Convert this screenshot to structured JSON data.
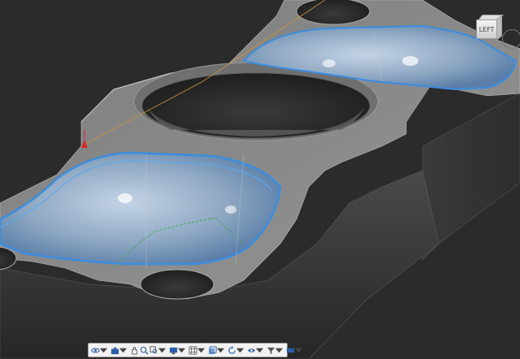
{
  "viewcube": {
    "face_label": "LEFT"
  },
  "toolbar": {
    "tools": [
      {
        "name": "orbit",
        "icon": "orbit-icon"
      },
      {
        "name": "orbit-dropdown",
        "icon": "chevron-down-icon"
      },
      {
        "name": "capture",
        "icon": "camera-icon"
      },
      {
        "name": "capture-dropdown",
        "icon": "chevron-down-icon"
      },
      {
        "name": "pan",
        "icon": "pan-icon"
      },
      {
        "name": "zoom",
        "icon": "zoom-icon"
      },
      {
        "name": "zoom-window",
        "icon": "zoom-window-icon"
      },
      {
        "name": "zoom-dropdown",
        "icon": "chevron-down-icon"
      },
      {
        "name": "display-mode",
        "icon": "display-icon"
      },
      {
        "name": "display-dropdown",
        "icon": "chevron-down-icon"
      },
      {
        "name": "grid",
        "icon": "grid-icon"
      },
      {
        "name": "grid-dropdown",
        "icon": "chevron-down-icon"
      },
      {
        "name": "section",
        "icon": "section-icon"
      },
      {
        "name": "section-dropdown",
        "icon": "chevron-down-icon"
      },
      {
        "name": "rotate",
        "icon": "rotate-icon"
      },
      {
        "name": "rotate-dropdown",
        "icon": "chevron-down-icon"
      },
      {
        "name": "visibility",
        "icon": "eye-icon"
      },
      {
        "name": "visibility-dropdown",
        "icon": "chevron-down-icon"
      },
      {
        "name": "filter",
        "icon": "filter-icon"
      },
      {
        "name": "filter-dropdown",
        "icon": "chevron-down-icon"
      },
      {
        "name": "simulate",
        "icon": "simulate-icon"
      },
      {
        "name": "simulate-dropdown",
        "icon": "chevron-down-icon"
      }
    ]
  },
  "colors": {
    "background": "#2b2b2b",
    "part": "#8a8a8a",
    "toolpath": "#3a8ee0",
    "accent": "#2a5fa8"
  }
}
